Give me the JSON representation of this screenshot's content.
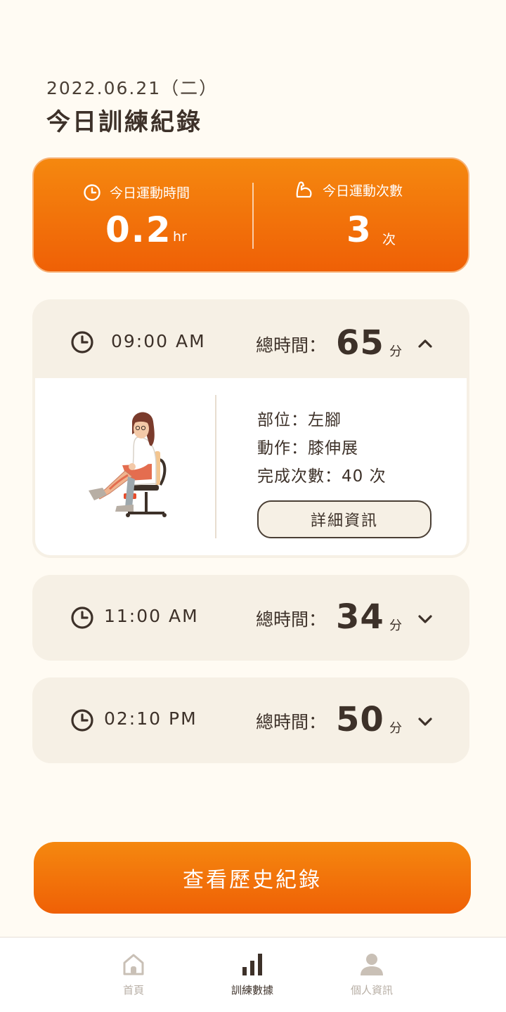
{
  "header": {
    "date": "2022.06.21（二）",
    "title": "今日訓練紀錄"
  },
  "summary": {
    "time_label": "今日運動時間",
    "time_value": "0.2",
    "time_unit": "hr",
    "count_label": "今日運動次數",
    "count_value": "3",
    "count_unit": "次",
    "time_icon": "clock-icon",
    "count_icon": "flexed-arm-icon"
  },
  "sessions": [
    {
      "time": "09:00 AM",
      "total_label": "總時間：",
      "total_value": "65",
      "total_unit": "分",
      "expanded": true,
      "details": {
        "part": "部位：左腳",
        "action": "動作：膝伸展",
        "reps": "完成次數：40 次",
        "button": "詳細資訊"
      }
    },
    {
      "time": "11:00 AM",
      "total_label": "總時間：",
      "total_value": "34",
      "total_unit": "分",
      "expanded": false
    },
    {
      "time": "02:10 PM",
      "total_label": "總時間：",
      "total_value": "50",
      "total_unit": "分",
      "expanded": false
    }
  ],
  "history_button": "查看歷史紀錄",
  "tabbar": {
    "items": [
      {
        "label": "首頁",
        "icon": "home-icon",
        "active": false
      },
      {
        "label": "訓練數據",
        "icon": "bar-chart-icon",
        "active": true
      },
      {
        "label": "個人資訊",
        "icon": "person-icon",
        "active": false
      }
    ]
  },
  "colors": {
    "background": "#fffbf3",
    "accent": "#f07a0a",
    "card": "#f6f0e5",
    "text": "#3d3129"
  }
}
